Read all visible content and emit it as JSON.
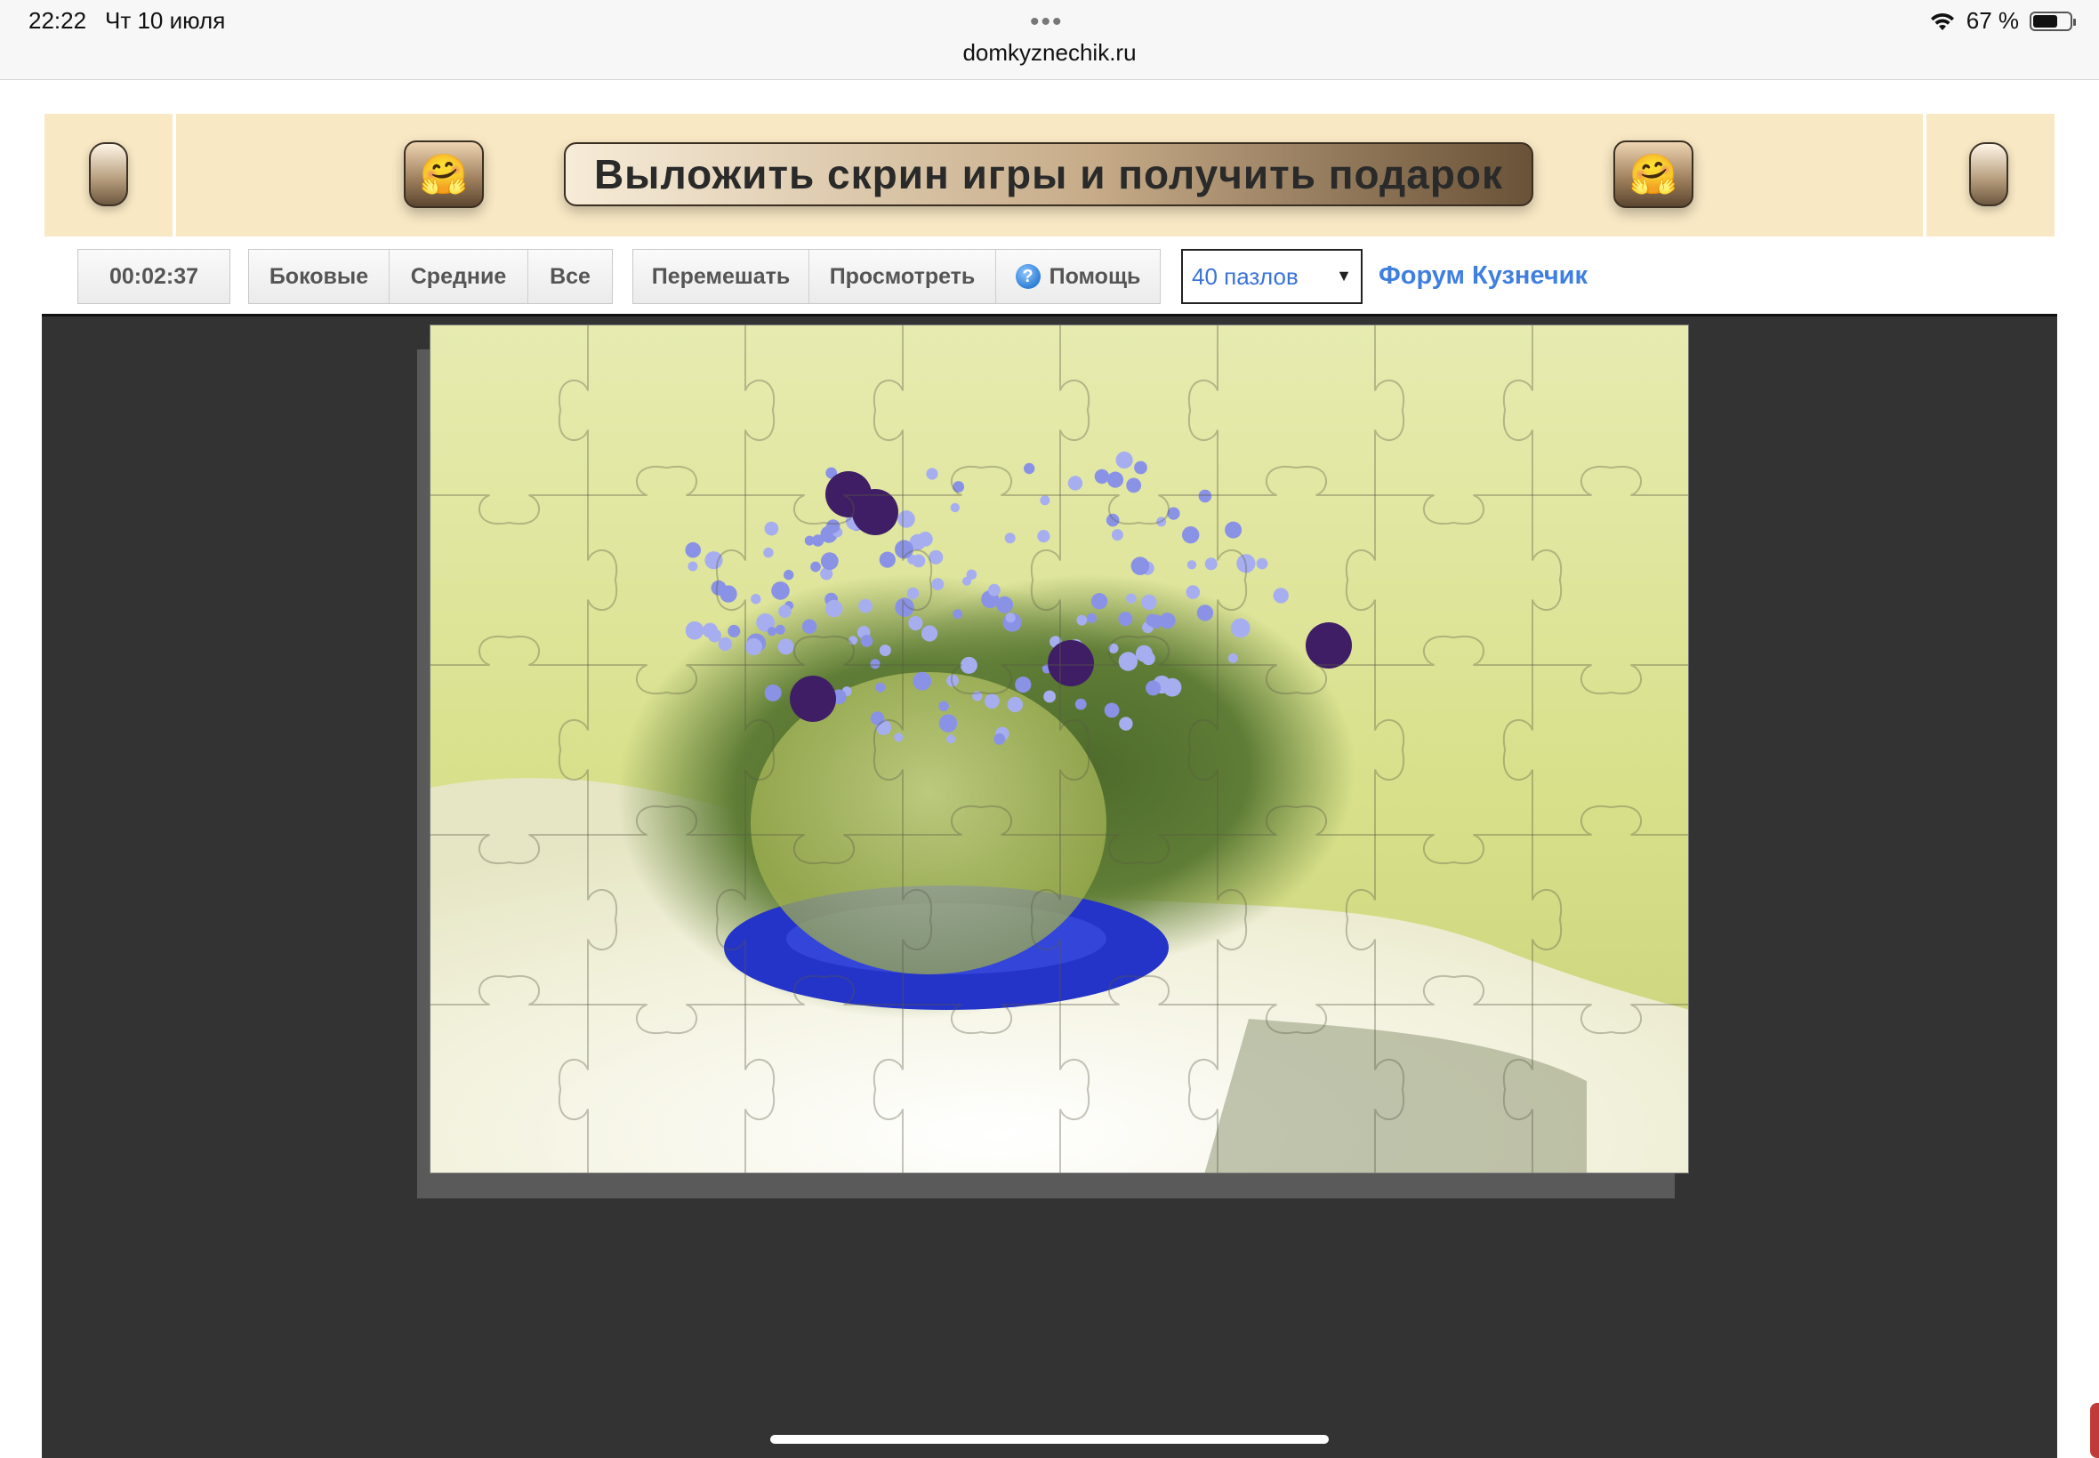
{
  "status_bar": {
    "time": "22:22",
    "date": "Чт 10 июля",
    "dots": "•••",
    "url": "domkyznechik.ru",
    "battery_percent": "67 %",
    "battery_level": 0.67
  },
  "banner": {
    "cta_text": "Выложить скрин игры и получить подарок",
    "emoji": "🤗"
  },
  "toolbar": {
    "timer": "00:02:37",
    "filter": [
      "Боковые",
      "Средние",
      "Все"
    ],
    "actions": [
      "Перемешать",
      "Просмотреть",
      "Помощь"
    ],
    "help_glyph": "?",
    "pieces_select": "40 пазлов",
    "select_arrow": "▼",
    "forum_link": "Форум Кузнечик"
  },
  "puzzle": {
    "columns": 8,
    "rows": 5,
    "pieces": 40
  },
  "colors": {
    "banner_bg": "#f8e8c4",
    "game_bg": "#333333",
    "link": "#3f7fe0"
  }
}
